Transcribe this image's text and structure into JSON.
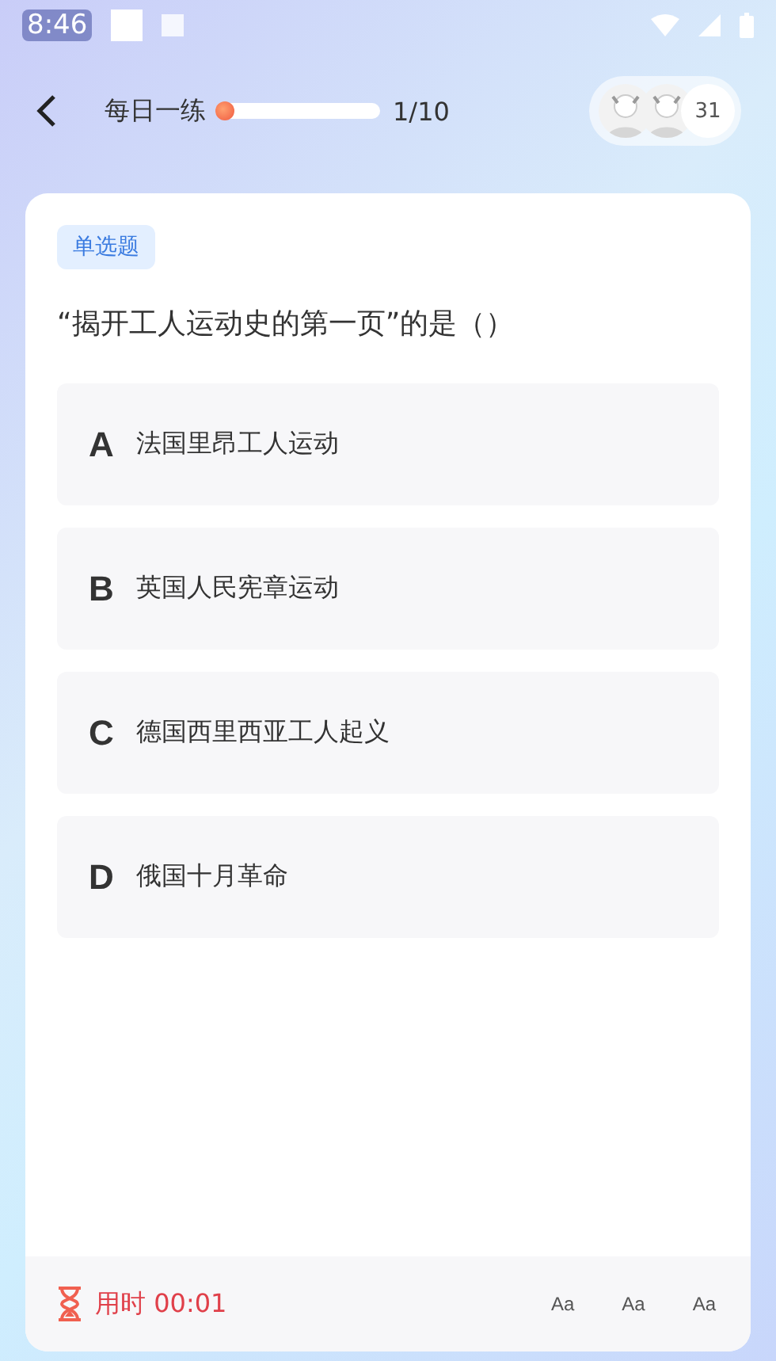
{
  "status_bar": {
    "time": "8:46"
  },
  "header": {
    "title": "每日一练",
    "progress": {
      "level": 0.02
    },
    "counter": "1/10",
    "participants": {
      "count": "31"
    }
  },
  "question": {
    "type_tag": "单选题",
    "text": "“揭开工人运动史的第一页”的是（）",
    "options": [
      {
        "letter": "A",
        "text": "法国里昂工人运动",
        "selected": false
      },
      {
        "letter": "B",
        "text": "英国人民宪章运动",
        "selected": false
      },
      {
        "letter": "C",
        "text": "德国西里西亚工人起义",
        "selected": false
      },
      {
        "letter": "D",
        "text": "俄国十月革命",
        "selected": false
      }
    ]
  },
  "footer": {
    "timer": "用时 00:01",
    "font_buttons": [
      "Aa",
      "Aa",
      "Aa"
    ]
  }
}
